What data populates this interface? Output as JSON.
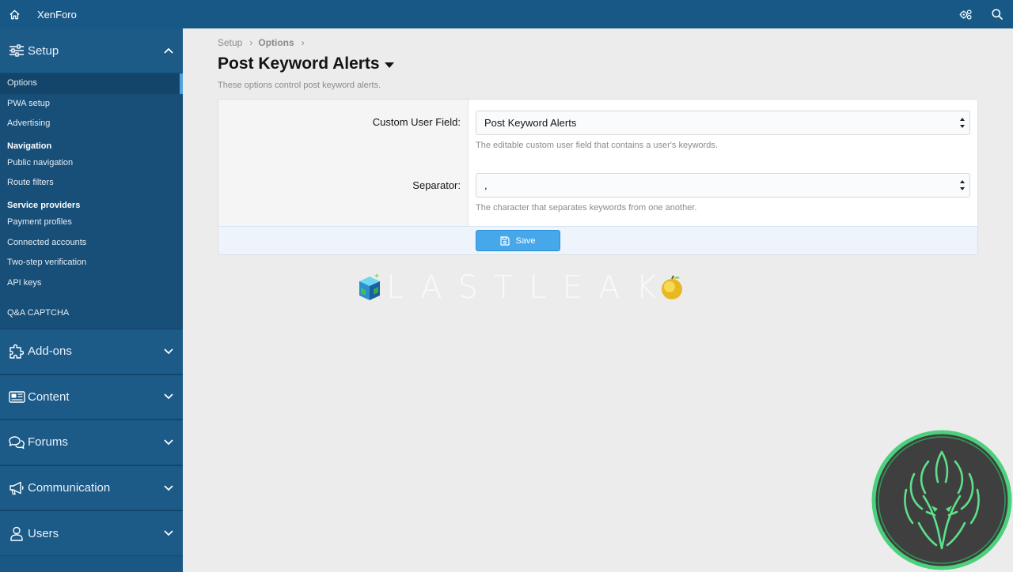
{
  "topbar": {
    "brand": "XenForo",
    "icons": [
      "home-icon",
      "settings-icon",
      "search-icon"
    ]
  },
  "sidebar": {
    "setup": {
      "label": "Setup",
      "groups": [
        {
          "heading": "",
          "items": [
            "Options",
            "PWA setup",
            "Advertising"
          ]
        },
        {
          "heading": "Navigation",
          "items": [
            "Public navigation",
            "Route filters"
          ]
        },
        {
          "heading": "Service providers",
          "items": [
            "Payment profiles",
            "Connected accounts",
            "Two-step verification",
            "API keys"
          ]
        },
        {
          "heading": "",
          "items": [
            "Q&A CAPTCHA"
          ]
        }
      ],
      "active_item": "Options"
    },
    "sections": [
      {
        "label": "Add-ons",
        "icon": "puzzle-icon"
      },
      {
        "label": "Content",
        "icon": "newspaper-icon"
      },
      {
        "label": "Forums",
        "icon": "comments-icon"
      },
      {
        "label": "Communication",
        "icon": "megaphone-icon"
      },
      {
        "label": "Users",
        "icon": "user-icon"
      }
    ]
  },
  "breadcrumb": {
    "items": [
      "Setup",
      "Options"
    ],
    "separator": "›"
  },
  "page": {
    "title": "Post Keyword Alerts",
    "description": "These options control post keyword alerts."
  },
  "form": {
    "rows": [
      {
        "label": "Custom User Field:",
        "value": "Post Keyword Alerts",
        "hint": "The editable custom user field that contains a user's keywords."
      },
      {
        "label": "Separator:",
        "value": ",",
        "hint": "The character that separates keywords from one another."
      }
    ],
    "save_label": "Save"
  },
  "watermark": {
    "text": "LASTLEAK"
  },
  "colors": {
    "topbar": "#185886",
    "sidebar": "#1a5784",
    "accent": "#47a7eb",
    "page_bg": "#ececec"
  }
}
